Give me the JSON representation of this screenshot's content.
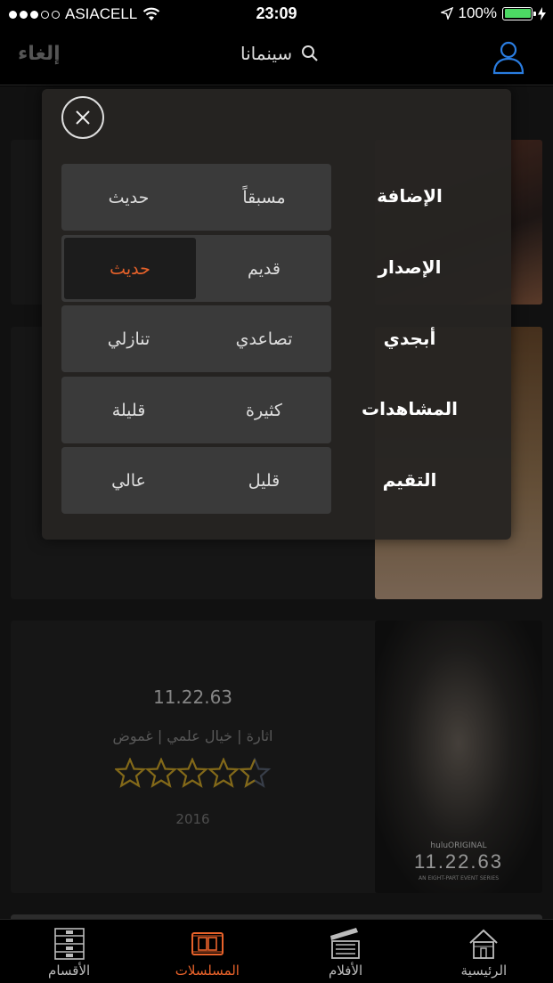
{
  "status_bar": {
    "carrier": "ASIACELL",
    "time": "23:09",
    "battery": "100%"
  },
  "nav": {
    "cancel_label": "إلغاء",
    "search_label": "سينمانا"
  },
  "sort_panel": {
    "rows": [
      {
        "label": "الإضافة",
        "option_right": "مسبقاً",
        "option_left": "حديث"
      },
      {
        "label": "الإصدار",
        "option_right": "قديم",
        "option_left": "حديث"
      },
      {
        "label": "أبجدي",
        "option_right": "تصاعدي",
        "option_left": "تنازلي"
      },
      {
        "label": "المشاهدات",
        "option_right": "كثيرة",
        "option_left": "قليلة"
      },
      {
        "label": "التقيم",
        "option_right": "قليل",
        "option_left": "عالي"
      }
    ],
    "selected": "الإصدار: حديث",
    "accent_color": "#e8622a"
  },
  "list": {
    "item": {
      "title": "11.22.63",
      "genres": "اثارة | خيال علمي | غموض",
      "rating": 4.5,
      "rating_max": 5,
      "year": "2016",
      "poster_text": "11.22.63",
      "poster_brand": "huluORIGINAL",
      "poster_tagline": "AN EIGHT-PART EVENT SERIES"
    }
  },
  "tabs": [
    {
      "label": "الأقسام",
      "icon": "sections-icon"
    },
    {
      "label": "المسلسلات",
      "icon": "film-strip-icon",
      "active": true
    },
    {
      "label": "الأفلام",
      "icon": "clapperboard-icon"
    },
    {
      "label": "الرئيسية",
      "icon": "home-icon"
    }
  ]
}
